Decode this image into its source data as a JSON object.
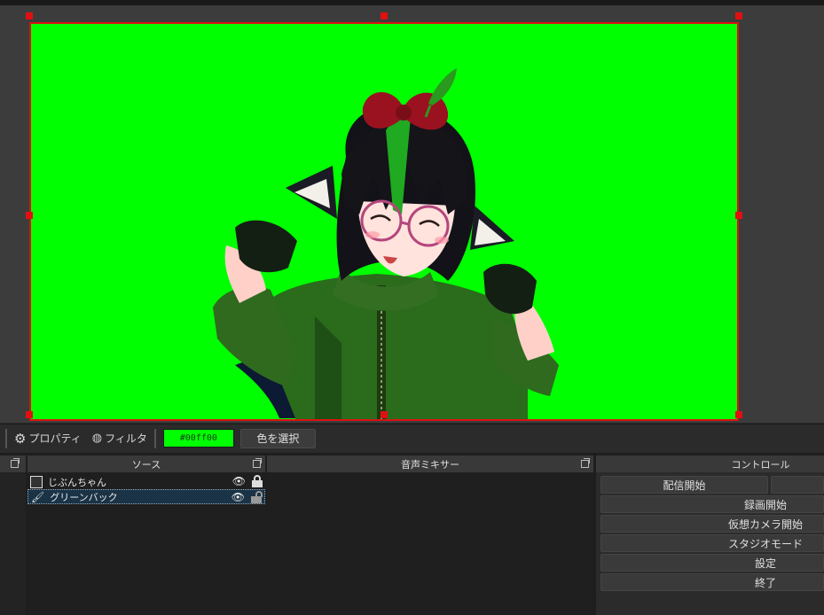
{
  "properties_bar": {
    "properties_label": "プロパティ",
    "filters_label": "フィルタ",
    "color_value": "#00ff00",
    "color_text": "#00ff00",
    "select_color_label": "色を選択"
  },
  "docks": {
    "sources": {
      "title": "ソース",
      "items": [
        {
          "name": "じぶんちゃん",
          "visible": true,
          "locked": true
        },
        {
          "name": "グリーンバック",
          "visible": true,
          "locked": false
        }
      ]
    },
    "mixer": {
      "title": "音声ミキサー"
    },
    "controls": {
      "title": "コントロール",
      "start_streaming": "配信開始",
      "start_recording": "録画開始",
      "start_virtual_camera": "仮想カメラ開始",
      "studio_mode": "スタジオモード",
      "settings": "設定",
      "exit": "終了"
    }
  },
  "colors": {
    "chroma_green": "#00ff00",
    "selection_border": "#dd1111"
  }
}
